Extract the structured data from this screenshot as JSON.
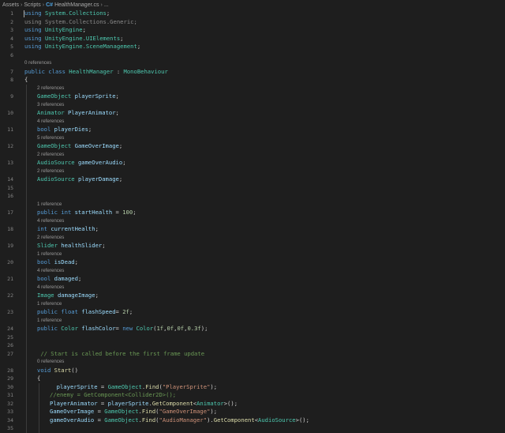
{
  "breadcrumb": {
    "items": [
      "Assets",
      "Scripts",
      "HealthManager.cs",
      "..."
    ],
    "file_icon": "C#"
  },
  "editor": {
    "lines": [
      {
        "n": "1",
        "t": [
          [
            "kw",
            "using"
          ],
          [
            "pl",
            " "
          ],
          [
            "ty",
            "System.Collections"
          ],
          [
            "pl",
            ";"
          ]
        ]
      },
      {
        "n": "2",
        "t": [
          [
            "dim",
            "using System.Collections.Generic;"
          ]
        ]
      },
      {
        "n": "3",
        "t": [
          [
            "kw",
            "using"
          ],
          [
            "pl",
            " "
          ],
          [
            "ty",
            "UnityEngine"
          ],
          [
            "pl",
            ";"
          ]
        ]
      },
      {
        "n": "4",
        "t": [
          [
            "kw",
            "using"
          ],
          [
            "pl",
            " "
          ],
          [
            "ty",
            "UnityEngine.UIElements"
          ],
          [
            "pl",
            ";"
          ]
        ]
      },
      {
        "n": "5",
        "t": [
          [
            "kw",
            "using"
          ],
          [
            "pl",
            " "
          ],
          [
            "ty",
            "UnityEngine.SceneManagement"
          ],
          [
            "pl",
            ";"
          ]
        ]
      },
      {
        "n": "6",
        "t": []
      },
      {
        "lens": "0 references"
      },
      {
        "n": "7",
        "t": [
          [
            "kw",
            "public"
          ],
          [
            "pl",
            " "
          ],
          [
            "kw",
            "class"
          ],
          [
            "pl",
            " "
          ],
          [
            "ty",
            "HealthManager"
          ],
          [
            "pl",
            " : "
          ],
          [
            "ty",
            "MonoBehaviour"
          ]
        ]
      },
      {
        "n": "8",
        "t": [
          [
            "pl",
            "{"
          ]
        ]
      },
      {
        "lens": "2 references",
        "i": 1
      },
      {
        "n": "9",
        "i": 1,
        "t": [
          [
            "ty",
            "GameObject"
          ],
          [
            "pl",
            " "
          ],
          [
            "id",
            "playerSprite"
          ],
          [
            "pl",
            ";"
          ]
        ]
      },
      {
        "lens": "3 references",
        "i": 1
      },
      {
        "n": "10",
        "i": 1,
        "t": [
          [
            "ty",
            "Animator"
          ],
          [
            "pl",
            " "
          ],
          [
            "id",
            "PlayerAnimator"
          ],
          [
            "pl",
            ";"
          ]
        ]
      },
      {
        "lens": "4 references",
        "i": 1
      },
      {
        "n": "11",
        "i": 1,
        "t": [
          [
            "kw",
            "bool"
          ],
          [
            "pl",
            " "
          ],
          [
            "id",
            "playerDies"
          ],
          [
            "pl",
            ";"
          ]
        ]
      },
      {
        "lens": "5 references",
        "i": 1
      },
      {
        "n": "12",
        "i": 1,
        "t": [
          [
            "ty",
            "GameObject"
          ],
          [
            "pl",
            " "
          ],
          [
            "id",
            "GameOverImage"
          ],
          [
            "pl",
            ";"
          ]
        ]
      },
      {
        "lens": "2 references",
        "i": 1
      },
      {
        "n": "13",
        "i": 1,
        "t": [
          [
            "ty",
            "AudioSource"
          ],
          [
            "pl",
            " "
          ],
          [
            "id",
            "gameOverAudio"
          ],
          [
            "pl",
            ";"
          ]
        ]
      },
      {
        "lens": "2 references",
        "i": 1
      },
      {
        "n": "14",
        "i": 1,
        "t": [
          [
            "ty",
            "AudioSource"
          ],
          [
            "pl",
            " "
          ],
          [
            "id",
            "playerDamage"
          ],
          [
            "pl",
            ";"
          ]
        ]
      },
      {
        "n": "15",
        "t": []
      },
      {
        "n": "16",
        "t": []
      },
      {
        "lens": "1 reference",
        "i": 1
      },
      {
        "n": "17",
        "i": 1,
        "t": [
          [
            "kw",
            "public"
          ],
          [
            "pl",
            " "
          ],
          [
            "kw",
            "int"
          ],
          [
            "pl",
            " "
          ],
          [
            "id",
            "startHealth"
          ],
          [
            "pl",
            " = "
          ],
          [
            "num",
            "100"
          ],
          [
            "pl",
            ";"
          ]
        ]
      },
      {
        "lens": "4 references",
        "i": 1
      },
      {
        "n": "18",
        "i": 1,
        "t": [
          [
            "kw",
            "int"
          ],
          [
            "pl",
            " "
          ],
          [
            "id",
            "currentHealth"
          ],
          [
            "pl",
            ";"
          ]
        ]
      },
      {
        "lens": "2 references",
        "i": 1
      },
      {
        "n": "19",
        "i": 1,
        "t": [
          [
            "ty",
            "Slider"
          ],
          [
            "pl",
            " "
          ],
          [
            "id",
            "healthSlider"
          ],
          [
            "pl",
            ";"
          ]
        ]
      },
      {
        "lens": "1 reference",
        "i": 1
      },
      {
        "n": "20",
        "i": 1,
        "t": [
          [
            "kw",
            "bool"
          ],
          [
            "pl",
            " "
          ],
          [
            "id",
            "isDead"
          ],
          [
            "pl",
            ";"
          ]
        ]
      },
      {
        "lens": "4 references",
        "i": 1
      },
      {
        "n": "21",
        "i": 1,
        "t": [
          [
            "kw",
            "bool"
          ],
          [
            "pl",
            " "
          ],
          [
            "id",
            "damaged"
          ],
          [
            "pl",
            ";"
          ]
        ]
      },
      {
        "lens": "4 references",
        "i": 1
      },
      {
        "n": "22",
        "i": 1,
        "t": [
          [
            "ty",
            "Image"
          ],
          [
            "pl",
            " "
          ],
          [
            "id",
            "damageImage"
          ],
          [
            "pl",
            ";"
          ]
        ]
      },
      {
        "lens": "1 reference",
        "i": 1
      },
      {
        "n": "23",
        "i": 1,
        "t": [
          [
            "kw",
            "public"
          ],
          [
            "pl",
            " "
          ],
          [
            "kw",
            "float"
          ],
          [
            "pl",
            " "
          ],
          [
            "id",
            "flashSpeed"
          ],
          [
            "pl",
            "= "
          ],
          [
            "num",
            "2f"
          ],
          [
            "pl",
            ";"
          ]
        ]
      },
      {
        "lens": "1 reference",
        "i": 1
      },
      {
        "n": "24",
        "i": 1,
        "t": [
          [
            "kw",
            "public"
          ],
          [
            "pl",
            " "
          ],
          [
            "ty",
            "Color"
          ],
          [
            "pl",
            " "
          ],
          [
            "id",
            "flashColor"
          ],
          [
            "pl",
            "= "
          ],
          [
            "kw",
            "new"
          ],
          [
            "pl",
            " "
          ],
          [
            "ty",
            "Color"
          ],
          [
            "pl",
            "("
          ],
          [
            "num",
            "1f"
          ],
          [
            "pl",
            ","
          ],
          [
            "num",
            "0f"
          ],
          [
            "pl",
            ","
          ],
          [
            "num",
            "0f"
          ],
          [
            "pl",
            ","
          ],
          [
            "num",
            "0.3f"
          ],
          [
            "pl",
            ");"
          ]
        ]
      },
      {
        "n": "25",
        "t": []
      },
      {
        "n": "26",
        "t": []
      },
      {
        "n": "27",
        "i": 1,
        "t": [
          [
            "cm",
            " // Start is called before the first frame update"
          ]
        ]
      },
      {
        "lens": "0 references",
        "i": 1
      },
      {
        "n": "28",
        "i": 1,
        "t": [
          [
            "kw",
            "void"
          ],
          [
            "pl",
            " "
          ],
          [
            "fn",
            "Start"
          ],
          [
            "pl",
            "()"
          ]
        ]
      },
      {
        "n": "29",
        "i": 1,
        "t": [
          [
            "pl",
            "{"
          ]
        ]
      },
      {
        "n": "30",
        "i": 2,
        "t": [
          [
            "pl",
            "  "
          ],
          [
            "id",
            "playerSprite"
          ],
          [
            "pl",
            " = "
          ],
          [
            "ty",
            "GameObject"
          ],
          [
            "pl",
            "."
          ],
          [
            "fn",
            "Find"
          ],
          [
            "pl",
            "("
          ],
          [
            "str",
            "\"PlayerSprite\""
          ],
          [
            "pl",
            ");"
          ]
        ]
      },
      {
        "n": "31",
        "i": 2,
        "t": [
          [
            "cm",
            "//enemy = GetComponent<Collider2D>();"
          ]
        ]
      },
      {
        "n": "32",
        "i": 2,
        "t": [
          [
            "id",
            "PlayerAnimator"
          ],
          [
            "pl",
            " = "
          ],
          [
            "id",
            "playerSprite"
          ],
          [
            "pl",
            "."
          ],
          [
            "fn",
            "GetComponent"
          ],
          [
            "pl",
            "<"
          ],
          [
            "ty",
            "Animator"
          ],
          [
            "pl",
            ">();"
          ]
        ]
      },
      {
        "n": "33",
        "i": 2,
        "t": [
          [
            "id",
            "GameOverImage"
          ],
          [
            "pl",
            " = "
          ],
          [
            "ty",
            "GameObject"
          ],
          [
            "pl",
            "."
          ],
          [
            "fn",
            "Find"
          ],
          [
            "pl",
            "("
          ],
          [
            "str",
            "\"GameOverImage\""
          ],
          [
            "pl",
            ");"
          ]
        ]
      },
      {
        "n": "34",
        "i": 2,
        "t": [
          [
            "id",
            "gameOverAudio"
          ],
          [
            "pl",
            " = "
          ],
          [
            "ty",
            "GameObject"
          ],
          [
            "pl",
            "."
          ],
          [
            "fn",
            "Find"
          ],
          [
            "pl",
            "("
          ],
          [
            "str",
            "\"AudioManager\""
          ],
          [
            "pl",
            ")."
          ],
          [
            "fn",
            "GetComponent"
          ],
          [
            "pl",
            "<"
          ],
          [
            "ty",
            "AudioSource"
          ],
          [
            "pl",
            ">();"
          ]
        ]
      },
      {
        "n": "35",
        "t": []
      }
    ]
  }
}
